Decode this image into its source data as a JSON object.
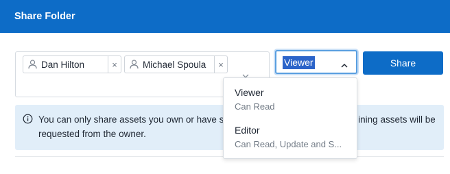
{
  "header": {
    "title": "Share Folder"
  },
  "recipients": [
    {
      "name": "Dan Hilton",
      "remove": "×"
    },
    {
      "name": "Michael Spoula",
      "remove": "×"
    }
  ],
  "role_select": {
    "value": "Viewer"
  },
  "share_button": {
    "label": "Share"
  },
  "info": {
    "text": "You can only share assets you own or have s​                             ining assets will be requested from the owner."
  },
  "dropdown": {
    "options": [
      {
        "title": "Viewer",
        "description": "Can Read"
      },
      {
        "title": "Editor",
        "description": "Can Read, Update and S..."
      }
    ]
  },
  "colors": {
    "primary": "#0d6cc7",
    "info_bg": "#e1eef9",
    "selection": "#2c64c9"
  }
}
